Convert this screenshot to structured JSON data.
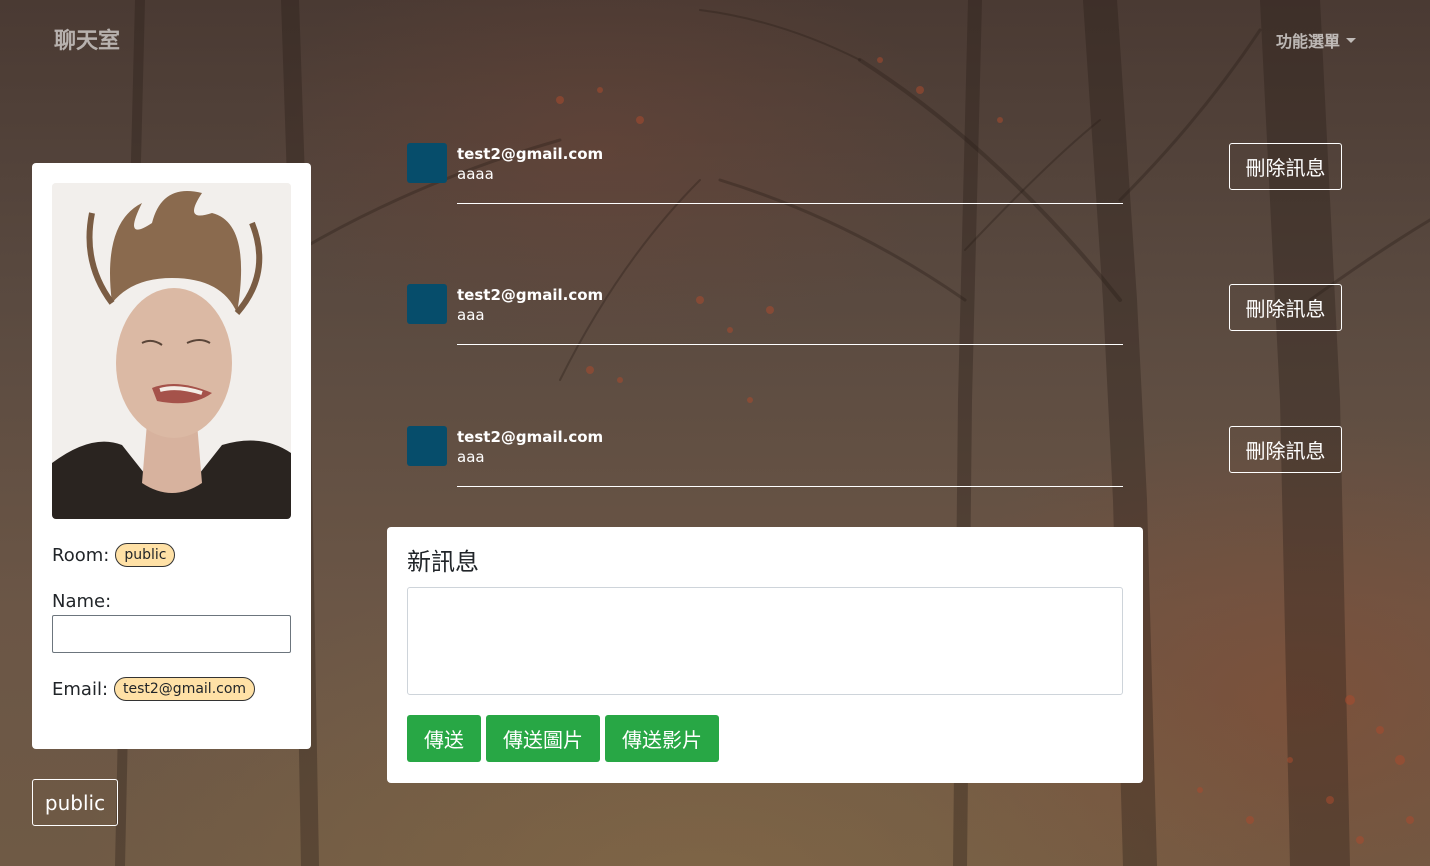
{
  "navbar": {
    "brand": "聊天室",
    "menu_label": "功能選單"
  },
  "profile": {
    "room_label": "Room:",
    "room_value": "public",
    "name_label": "Name:",
    "name_value": "",
    "email_label": "Email:",
    "email_value": "test2@gmail.com"
  },
  "room_button": "public",
  "messages": [
    {
      "email": "test2@gmail.com",
      "text": "aaaa",
      "delete_label": "刪除訊息"
    },
    {
      "email": "test2@gmail.com",
      "text": "aaa",
      "delete_label": "刪除訊息"
    },
    {
      "email": "test2@gmail.com",
      "text": "aaa",
      "delete_label": "刪除訊息"
    }
  ],
  "compose": {
    "title": "新訊息",
    "input_value": "",
    "send_label": "傳送",
    "send_image_label": "傳送圖片",
    "send_video_label": "傳送影片"
  },
  "colors": {
    "avatar": "#064d6b",
    "pill": "#ffe1a6",
    "send_button": "#28a745"
  }
}
